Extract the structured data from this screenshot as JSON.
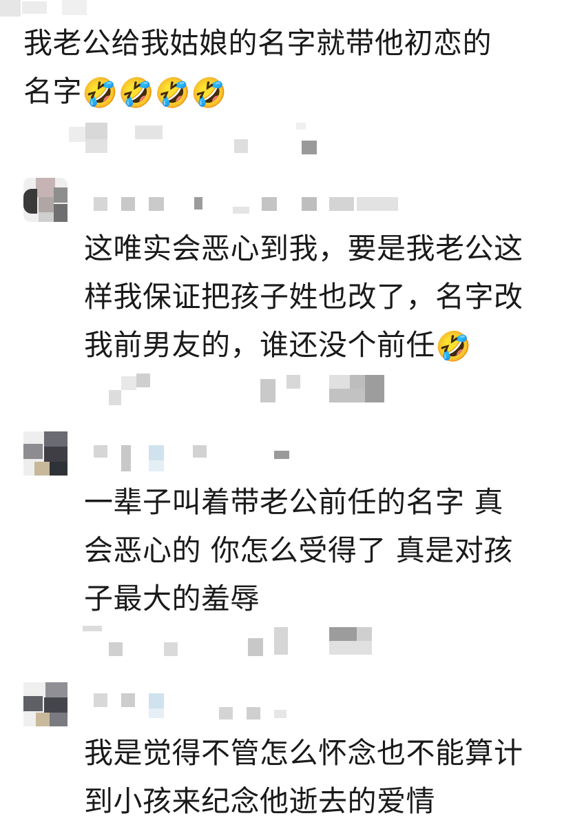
{
  "top_comment": {
    "line1": "我老公给我姑娘的名字就带他初恋的",
    "line2": "名字",
    "emojis": [
      "🤣",
      "🤣",
      "🤣",
      "🤣"
    ]
  },
  "replies": [
    {
      "lines": [
        "这唯实会恶心到我，要是我老公这",
        "样我保证把孩子姓也改了，名字改",
        "我前男友的，谁还没个前任"
      ],
      "trailing_emoji": "🤣"
    },
    {
      "lines": [
        "一辈子叫着带老公前任的名字  真",
        "会恶心的 你怎么受得了 真是对孩",
        "子最大的羞辱"
      ]
    },
    {
      "lines": [
        "我是觉得不管怎么怀念也不能算计",
        "到小孩来纪念他逝去的爱情"
      ]
    }
  ]
}
